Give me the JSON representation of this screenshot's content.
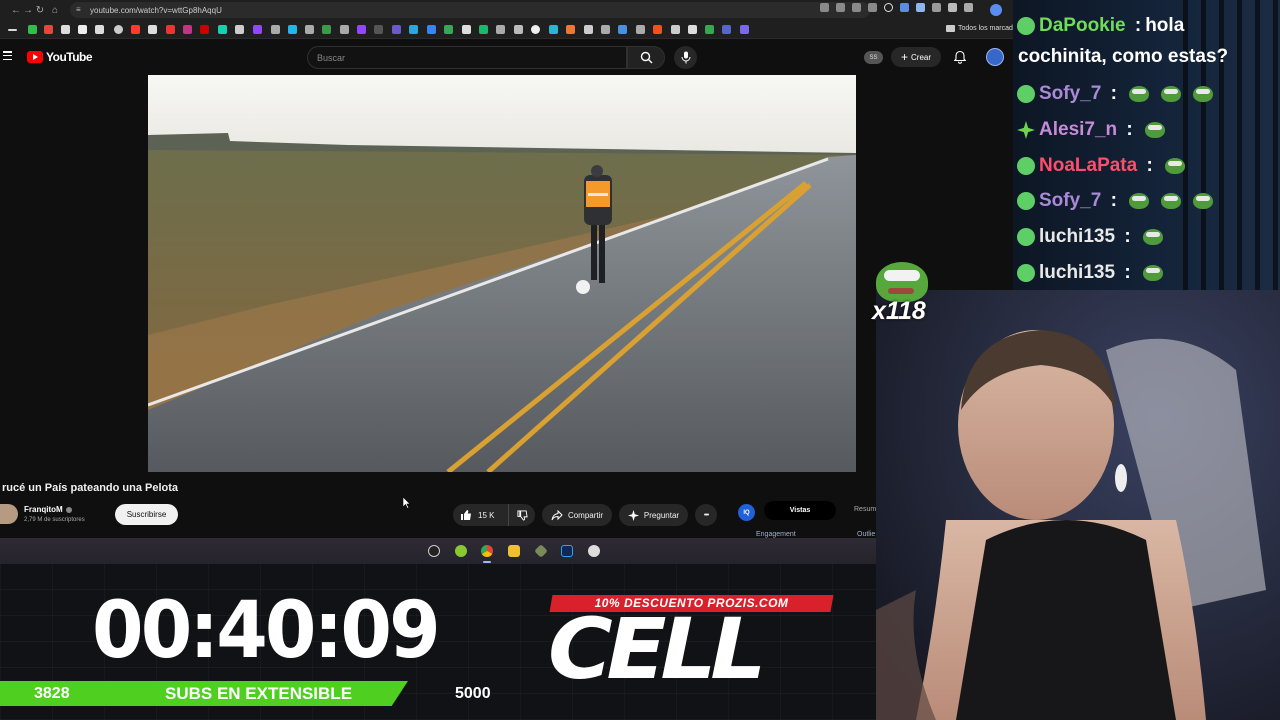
{
  "browser": {
    "url": "youtube.com/watch?v=wttGp8hAqqU",
    "bookmarks_all": "Todos los marcadores"
  },
  "youtube": {
    "logo_text": "YouTube",
    "search_placeholder": "Buscar",
    "user_badge": "SS",
    "create_label": "Crear"
  },
  "video": {
    "title": "rucé un País pateando una Pelota",
    "channel": "FranqitoM",
    "subscribers": "2,79 M de suscriptores",
    "subscribe_label": "Suscribirse",
    "likes": "15 K",
    "share_label": "Compartir",
    "ask_label": "Preguntar",
    "more_label": "•••"
  },
  "side_panel": {
    "icon_label": "IQ",
    "tab_active": "Vistas",
    "tab_next": "Resum",
    "engagement_label": "Engagement",
    "outline_label": "Outlie"
  },
  "stream": {
    "timer": "00:40:09",
    "subs_current": "3828",
    "subs_label": "SUBS EN EXTENSIBLE",
    "subs_goal": "5000",
    "subs_progress": 0.7656,
    "promo": "10% DESCUENTO PROZIS.COM",
    "sponsor": "CELL",
    "emote_combo": "x118"
  },
  "chat": {
    "messages": [
      {
        "user": "DaPookie",
        "color": "#6fdc5a",
        "text": "hola"
      },
      {
        "user": "Sofy_7",
        "color": "#a98ad6",
        "text": ""
      },
      {
        "user": "Alesi7_n",
        "color": "#c68bd8",
        "text": ""
      },
      {
        "user": "NoaLaPata",
        "color": "#ff4d6d",
        "text": ""
      },
      {
        "user": "Sofy_7",
        "color": "#a98ad6",
        "text": ""
      },
      {
        "user": "luchi135",
        "color": "#e8e8e8",
        "text": ""
      },
      {
        "user": "luchi135",
        "color": "#e8e8e8",
        "text": ""
      }
    ],
    "continuation": "cochinita, como estas?"
  }
}
